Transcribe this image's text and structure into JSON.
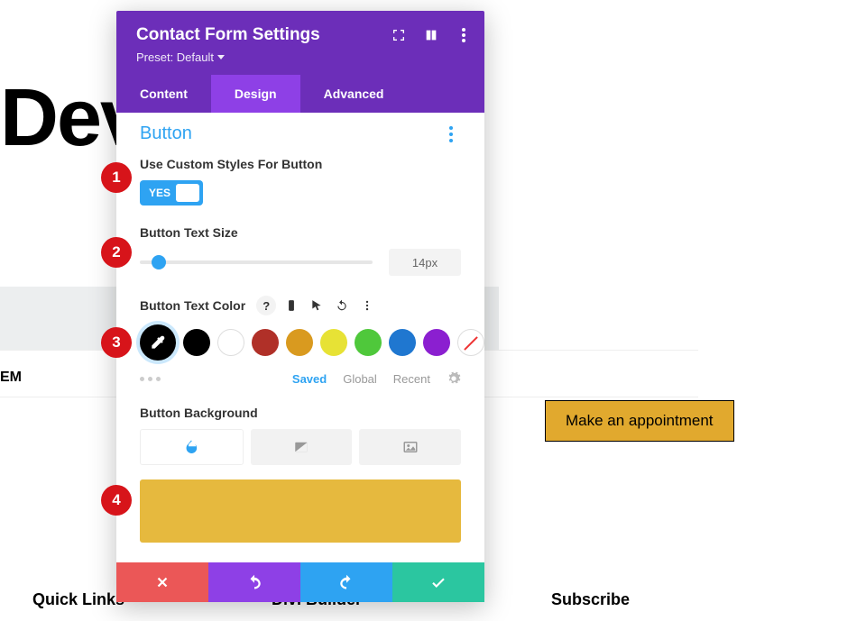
{
  "page": {
    "background_title": "Dev             ct Us",
    "small_label": "EM",
    "cta_label": "Make an appointment"
  },
  "footer": [
    "Quick Links",
    "Divi Builder",
    "Subscribe"
  ],
  "modal": {
    "title": "Contact Form Settings",
    "preset": "Preset: Default",
    "tabs": [
      "Content",
      "Design",
      "Advanced"
    ],
    "active_tab": 1,
    "section_title": "Button",
    "use_custom_label": "Use Custom Styles For Button",
    "toggle_value": "YES",
    "text_size_label": "Button Text Size",
    "text_size_value": "14px",
    "text_color_label": "Button Text Color",
    "swatches": [
      {
        "name": "eyedropper",
        "hex": "#000000"
      },
      {
        "name": "black",
        "hex": "#000000"
      },
      {
        "name": "white",
        "hex": "#ffffff"
      },
      {
        "name": "red",
        "hex": "#b03028"
      },
      {
        "name": "orange",
        "hex": "#d99a1f"
      },
      {
        "name": "yellow",
        "hex": "#e7e235"
      },
      {
        "name": "green",
        "hex": "#4fc83b"
      },
      {
        "name": "blue",
        "hex": "#1f77d0"
      },
      {
        "name": "purple",
        "hex": "#8b1fd0"
      },
      {
        "name": "none",
        "hex": "transparent"
      }
    ],
    "saved_tabs": [
      "Saved",
      "Global",
      "Recent"
    ],
    "bg_label": "Button Background",
    "bg_color": "#e6b93e"
  },
  "badges": [
    "1",
    "2",
    "3",
    "4"
  ]
}
